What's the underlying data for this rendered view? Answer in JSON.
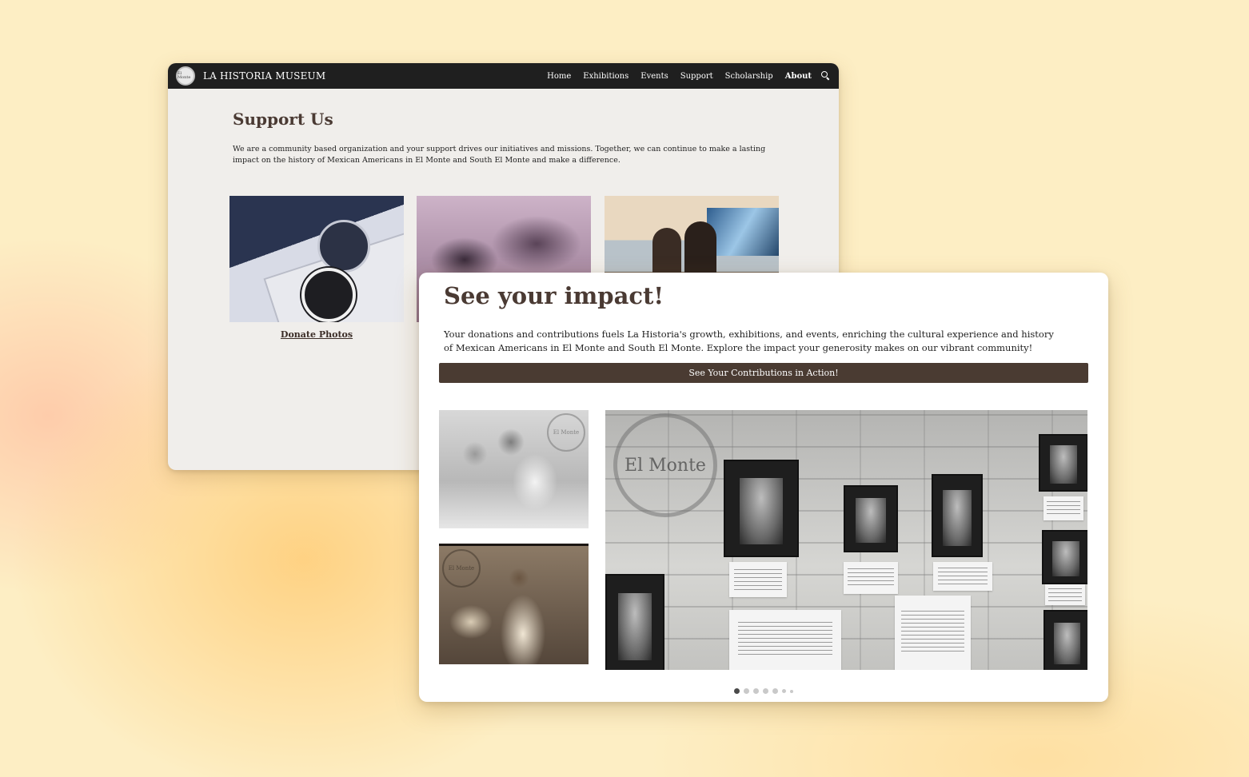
{
  "site": {
    "logo_text": "El Monte",
    "name": "LA HISTORIA MUSEUM"
  },
  "nav": {
    "items": [
      {
        "label": "Home",
        "active": false
      },
      {
        "label": "Exhibitions",
        "active": false
      },
      {
        "label": "Events",
        "active": false
      },
      {
        "label": "Support",
        "active": false
      },
      {
        "label": "Scholarship",
        "active": false
      },
      {
        "label": "About",
        "active": true
      }
    ],
    "search_icon": "search-icon"
  },
  "support": {
    "title": "Support Us",
    "description": "We are a community based organization and your support drives our initiatives and missions. Together, we can continue to make a lasting impact on the history of Mexican Americans in El Monte and South El Monte and make a difference.",
    "cards": [
      {
        "label": "Donate Photos"
      }
    ]
  },
  "impact": {
    "title": "See your impact!",
    "description": "Your donations and contributions fuels La Historia's growth, exhibitions, and events, enriching the cultural experience and history of Mexican Americans in El Monte and South El Monte. Explore the impact your generosity makes on our vibrant community!",
    "cta_label": "See Your Contributions in Action!",
    "stamp_text": "El Monte",
    "wall_text": "El Monte",
    "slider": {
      "total_dots": 7,
      "active_index": 0
    }
  },
  "colors": {
    "brand_brown": "#4a3b32",
    "heading_brown": "#4a3a33",
    "navbar": "#1f1f1f",
    "background": "#fdeec4"
  }
}
